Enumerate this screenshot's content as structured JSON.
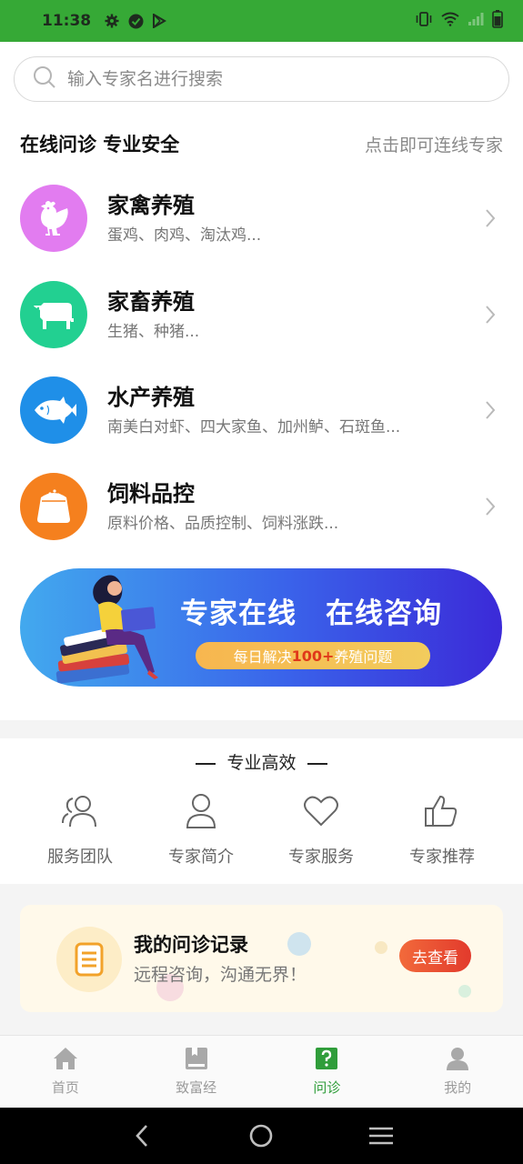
{
  "status_bar": {
    "time": "11:38",
    "icons": [
      "gear-icon",
      "check-circle-icon",
      "play-store-icon",
      "vibrate-icon",
      "wifi-icon",
      "signal-icon",
      "battery-icon"
    ]
  },
  "search": {
    "placeholder": "输入专家名进行搜索"
  },
  "section": {
    "title": "在线问诊 专业安全",
    "hint": "点击即可连线专家"
  },
  "categories": [
    {
      "name": "家禽养殖",
      "desc": "蛋鸡、肉鸡、淘汰鸡...",
      "icon": "chicken-icon",
      "color": "#e27cf0"
    },
    {
      "name": "家畜养殖",
      "desc": "生猪、种猪...",
      "icon": "cow-icon",
      "color": "#22d091"
    },
    {
      "name": "水产养殖",
      "desc": "南美白对虾、四大家鱼、加州鲈、石斑鱼...",
      "icon": "fish-icon",
      "color": "#1f8fe8"
    },
    {
      "name": "饲料品控",
      "desc": "原料价格、品质控制、饲料涨跌...",
      "icon": "feed-bag-icon",
      "color": "#f5801e"
    }
  ],
  "banner": {
    "title": "专家在线　在线咨询",
    "pill_prefix": "每日解决",
    "pill_highlight": "100+",
    "pill_suffix": "养殖问题"
  },
  "features": {
    "heading": "专业高效",
    "items": [
      {
        "label": "服务团队",
        "icon": "team-icon"
      },
      {
        "label": "专家简介",
        "icon": "person-icon"
      },
      {
        "label": "专家服务",
        "icon": "heart-icon"
      },
      {
        "label": "专家推荐",
        "icon": "thumbs-up-icon"
      }
    ]
  },
  "records": {
    "title": "我的问诊记录",
    "subtitle": "远程咨询，沟通无界！",
    "button": "去查看",
    "icon": "document-icon"
  },
  "tabs": [
    {
      "label": "首页",
      "icon": "home-icon",
      "active": false
    },
    {
      "label": "致富经",
      "icon": "book-icon",
      "active": false
    },
    {
      "label": "问诊",
      "icon": "question-icon",
      "active": true
    },
    {
      "label": "我的",
      "icon": "user-icon",
      "active": false
    }
  ],
  "colors": {
    "status_bar": "#36a936",
    "active_tab": "#2f9d3a",
    "banner_start": "#42a9ee",
    "banner_end": "#3b2ad8",
    "button": "#e23a2c"
  }
}
